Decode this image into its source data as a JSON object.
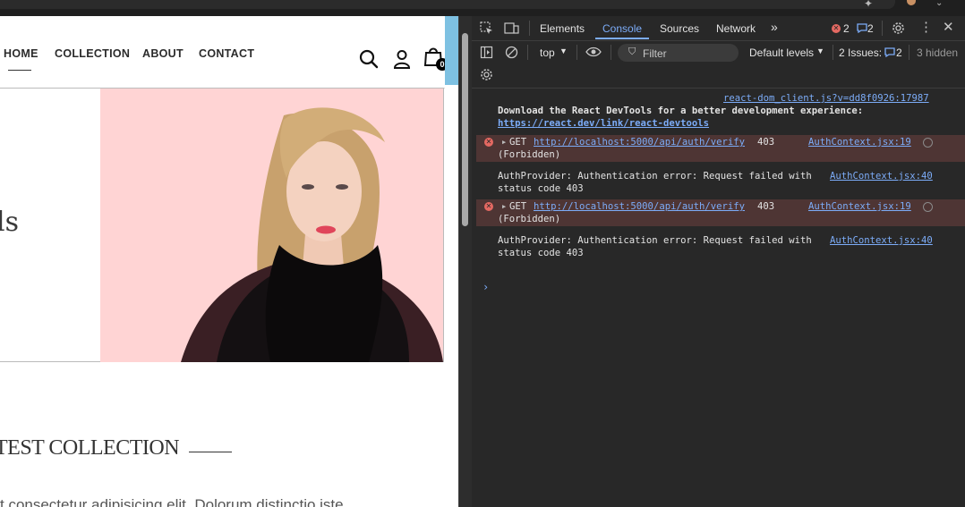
{
  "site": {
    "nav": {
      "items": [
        {
          "label": "HOME"
        },
        {
          "label": "COLLECTION"
        },
        {
          "label": "ABOUT"
        },
        {
          "label": "CONTACT"
        }
      ],
      "icons": [
        "search-icon",
        "user-icon",
        "shopping-bag-icon"
      ],
      "cart_count": "0"
    },
    "hero": {
      "heading_fragment": "ls"
    },
    "collection_title": "TEST COLLECTION",
    "lorem": "t consectetur adipisicing elit. Dolorum distinctio iste"
  },
  "devtools": {
    "tabs": [
      "Elements",
      "Console",
      "Sources",
      "Network"
    ],
    "active_tab": "Console",
    "error_count": "2",
    "message_count": "2",
    "toolbar": {
      "context": "top",
      "filter_placeholder": "Filter",
      "levels": "Default levels",
      "issues_label": "2 Issues:",
      "issues_count": "2",
      "hidden": "3 hidden"
    },
    "console": {
      "source_link": "react-dom_client.js?v=dd8f0926:17987",
      "devtools_msg": "Download the React DevTools for a better development experience:",
      "devtools_url": "https://react.dev/link/react-devtools",
      "errors": [
        {
          "method": "GET",
          "url": "http://localhost:5000/api/auth/verify",
          "status": "403",
          "status_text": "(Forbidden)",
          "source": "AuthContext.jsx:19"
        },
        {
          "method": "GET",
          "url": "http://localhost:5000/api/auth/verify",
          "status": "403",
          "status_text": "(Forbidden)",
          "source": "AuthContext.jsx:19"
        }
      ],
      "auth_logs": [
        {
          "text": "AuthProvider: Authentication error: Request failed with",
          "cont": "status code 403",
          "source": "AuthContext.jsx:40"
        },
        {
          "text": "AuthProvider: Authentication error: Request failed with",
          "cont": "status code 403",
          "source": "AuthContext.jsx:40"
        }
      ]
    }
  },
  "colors": {
    "devtools_bg": "#282828",
    "accent_blue": "#7cacf8",
    "error_bg": "#4e3534",
    "error_red": "#e46962",
    "hero_bg": "#ffd4d4"
  }
}
